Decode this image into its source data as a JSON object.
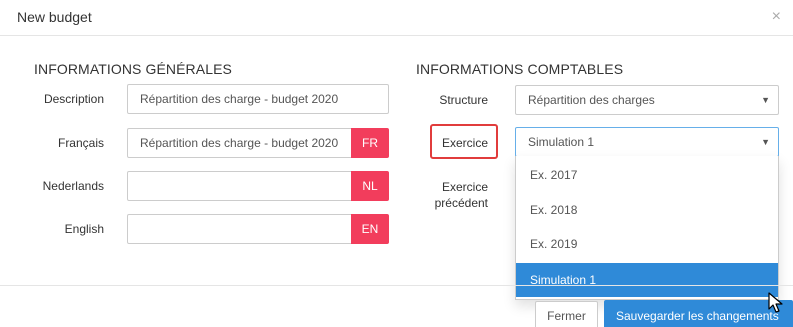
{
  "modal": {
    "title": "New budget",
    "close": "×"
  },
  "general": {
    "title": "INFORMATIONS GÉNÉRALES",
    "description": {
      "label": "Description",
      "value": "Répartition des charge - budget 2020"
    },
    "francais": {
      "label": "Français",
      "value": "Répartition des charge - budget 2020",
      "lang": "FR"
    },
    "nederlands": {
      "label": "Nederlands",
      "value": "",
      "lang": "NL"
    },
    "english": {
      "label": "English",
      "value": "",
      "lang": "EN"
    }
  },
  "accounting": {
    "title": "INFORMATIONS COMPTABLES",
    "structure": {
      "label": "Structure",
      "value": "Répartition des charges"
    },
    "exercice": {
      "label": "Exercice",
      "value": "Simulation 1"
    },
    "exercice_precedent": {
      "label_line1": "Exercice",
      "label_line2": "précédent"
    },
    "dropdown_options": [
      "Ex. 2017",
      "Ex. 2018",
      "Ex. 2019",
      "Simulation 1"
    ],
    "selected_option": "Simulation 1"
  },
  "footer": {
    "close_label": "Fermer",
    "save_label": "Sauvegarder les changements"
  },
  "colors": {
    "accent_red": "#f23d5c",
    "primary_blue": "#2f8ad8",
    "highlight_border": "#e13c3c"
  }
}
